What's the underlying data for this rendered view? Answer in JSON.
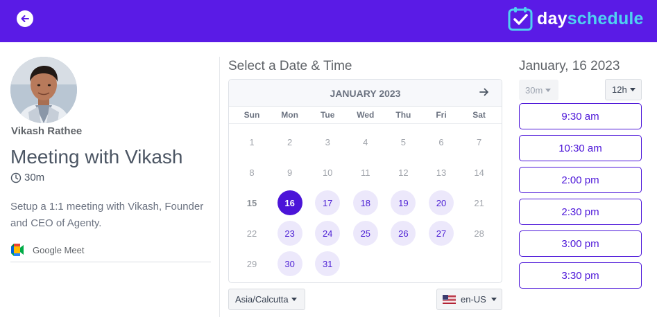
{
  "header": {
    "back_icon": "arrow-left-icon",
    "logo_icon": "calendar-check-icon",
    "logo_part1": "day",
    "logo_part2": "schedule",
    "brand_color": "#5a1be6"
  },
  "host": {
    "name": "Vikash Rathee",
    "avatar": "profile-photo"
  },
  "meeting": {
    "title": "Meeting with Vikash",
    "duration": "30m",
    "duration_icon": "clock-icon",
    "description": "Setup a 1:1 meeting with Vikash, Founder and CEO of Agenty.",
    "location": "Google Meet",
    "location_icon": "google-meet-icon"
  },
  "calendar": {
    "heading": "Select a Date & Time",
    "month": "JANUARY 2023",
    "next_icon": "arrow-right-icon",
    "weekdays": [
      "Sun",
      "Mon",
      "Tue",
      "Wed",
      "Thu",
      "Fri",
      "Sat"
    ],
    "weeks": [
      [
        {
          "d": "1",
          "s": "off"
        },
        {
          "d": "2",
          "s": "off"
        },
        {
          "d": "3",
          "s": "off"
        },
        {
          "d": "4",
          "s": "off"
        },
        {
          "d": "5",
          "s": "off"
        },
        {
          "d": "6",
          "s": "off"
        },
        {
          "d": "7",
          "s": "off"
        }
      ],
      [
        {
          "d": "8",
          "s": "off"
        },
        {
          "d": "9",
          "s": "off"
        },
        {
          "d": "10",
          "s": "off"
        },
        {
          "d": "11",
          "s": "off"
        },
        {
          "d": "12",
          "s": "off"
        },
        {
          "d": "13",
          "s": "off"
        },
        {
          "d": "14",
          "s": "off"
        }
      ],
      [
        {
          "d": "15",
          "s": "today"
        },
        {
          "d": "16",
          "s": "selected"
        },
        {
          "d": "17",
          "s": "avail"
        },
        {
          "d": "18",
          "s": "avail"
        },
        {
          "d": "19",
          "s": "avail"
        },
        {
          "d": "20",
          "s": "avail"
        },
        {
          "d": "21",
          "s": "off"
        }
      ],
      [
        {
          "d": "22",
          "s": "off"
        },
        {
          "d": "23",
          "s": "avail"
        },
        {
          "d": "24",
          "s": "avail"
        },
        {
          "d": "25",
          "s": "avail"
        },
        {
          "d": "26",
          "s": "avail"
        },
        {
          "d": "27",
          "s": "avail"
        },
        {
          "d": "28",
          "s": "off"
        }
      ],
      [
        {
          "d": "29",
          "s": "off"
        },
        {
          "d": "30",
          "s": "avail"
        },
        {
          "d": "31",
          "s": "avail"
        }
      ]
    ],
    "timezone": "Asia/Calcutta",
    "locale": "en-US",
    "locale_icon": "us-flag-icon"
  },
  "times": {
    "date_heading": "January, 16 2023",
    "duration_select": "30m",
    "format_select": "12h",
    "slots": [
      "9:30 am",
      "10:30 am",
      "2:00 pm",
      "2:30 pm",
      "3:00 pm",
      "3:30 pm"
    ]
  }
}
